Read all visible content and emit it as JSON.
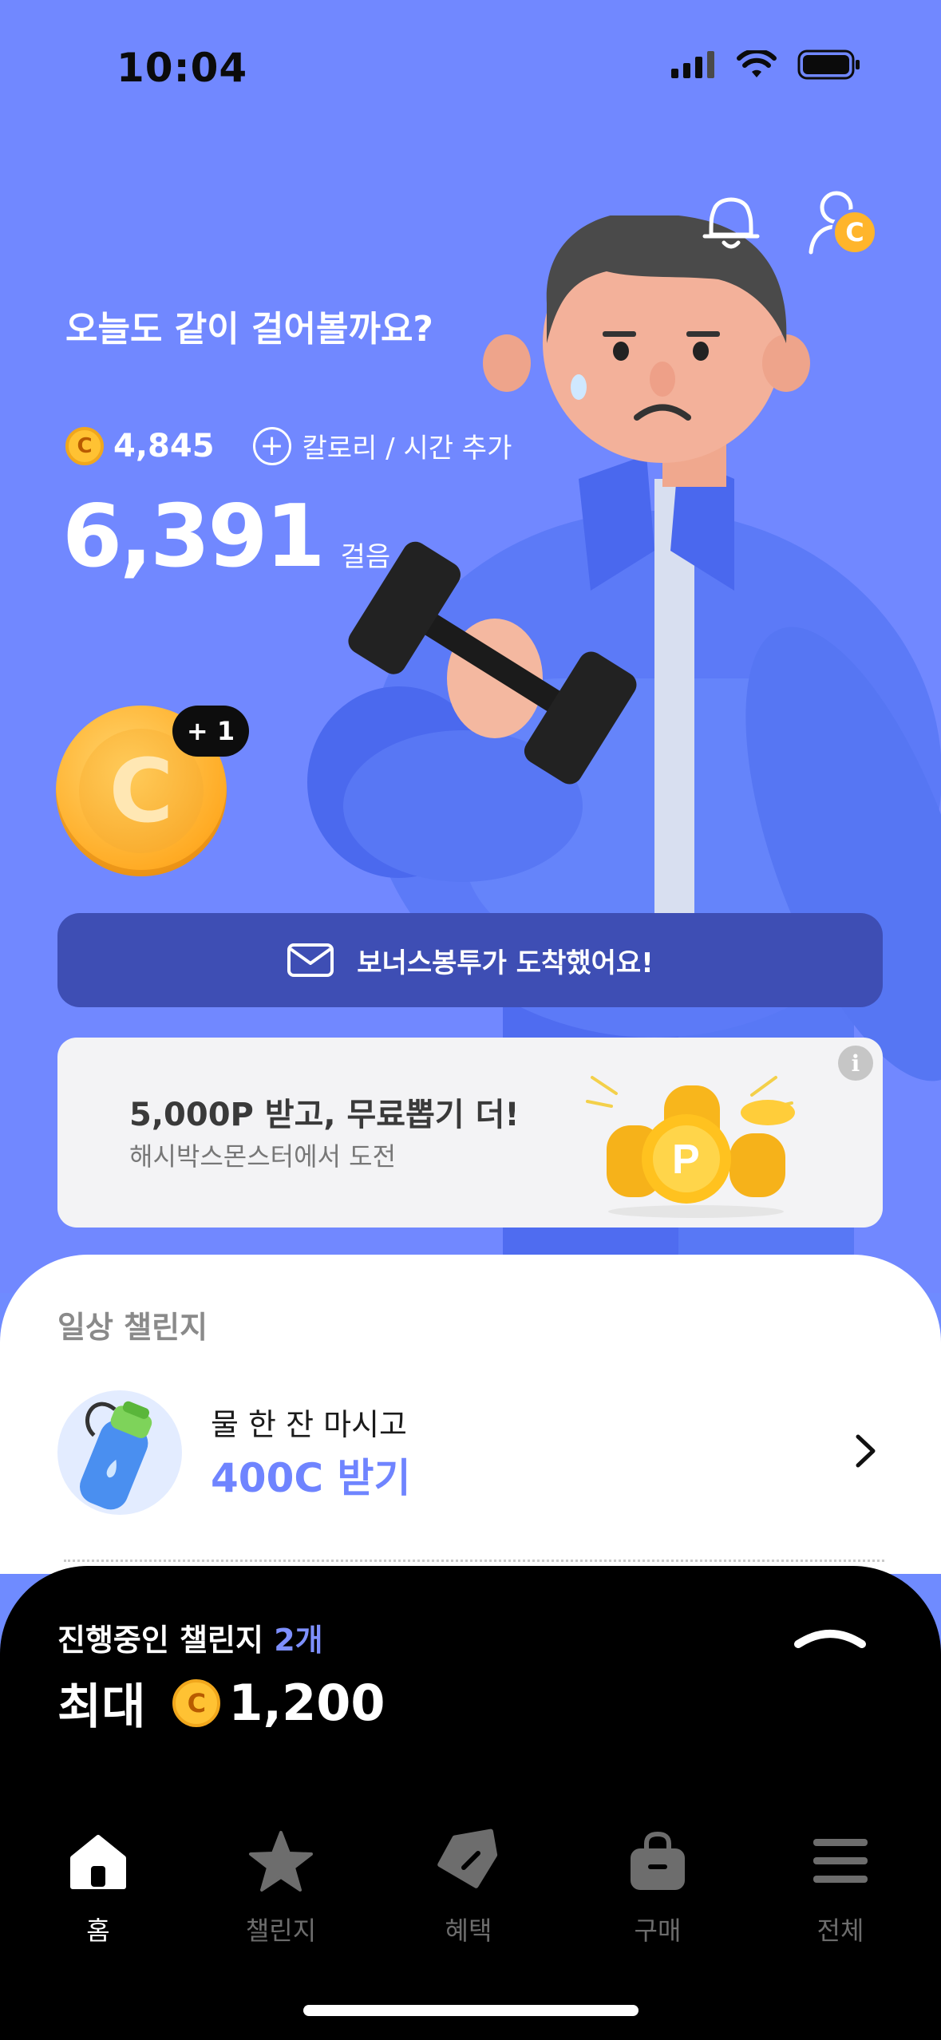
{
  "status_bar": {
    "time": "10:04"
  },
  "header": {
    "greeting": "오늘도 같이 걸어볼까요?",
    "profile_badge": "C"
  },
  "stats": {
    "coin_symbol": "C",
    "coin_balance": "4,845",
    "add_label": "칼로리 / 시간 추가",
    "steps": "6,391",
    "steps_unit": "걸음"
  },
  "reward_coin": {
    "symbol": "C",
    "plus": "+ 1"
  },
  "bonus_banner": {
    "label": "보너스봉투가 도착했어요!"
  },
  "promo": {
    "title": "5,000P 받고, 무료뽑기 더!",
    "subtitle": "해시박스몬스터에서 도전",
    "info": "i"
  },
  "daily_challenge": {
    "section_title": "일상 챌린지",
    "item_text": "물 한 잔 마시고",
    "item_reward": "400C 받기"
  },
  "ongoing": {
    "label": "진행중인 챌린지",
    "count": "2개",
    "max_label": "최대",
    "coin_symbol": "C",
    "max_value": "1,200"
  },
  "tabs": [
    {
      "label": "홈",
      "icon": "home-icon",
      "active": true
    },
    {
      "label": "챌린지",
      "icon": "star-icon",
      "active": false
    },
    {
      "label": "혜택",
      "icon": "tag-icon",
      "active": false
    },
    {
      "label": "구매",
      "icon": "bag-icon",
      "active": false
    },
    {
      "label": "전체",
      "icon": "menu-icon",
      "active": false
    }
  ],
  "colors": {
    "hero_bg": "#7188ff",
    "accent": "#6f84ff",
    "coin": "#ffc233",
    "banner": "#3e4eb4"
  }
}
